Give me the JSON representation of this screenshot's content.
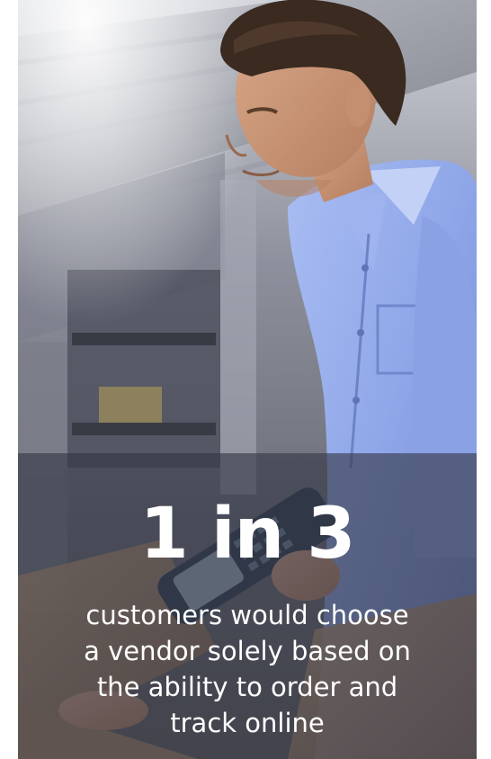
{
  "stat": {
    "headline": "1 in 3",
    "caption_lines": [
      "customers would choose",
      "a vendor solely based on",
      "the ability to order and",
      "track online"
    ]
  },
  "colors": {
    "overlay": "#343746",
    "shirt": "#8fa6e6",
    "text": "#ffffff"
  }
}
